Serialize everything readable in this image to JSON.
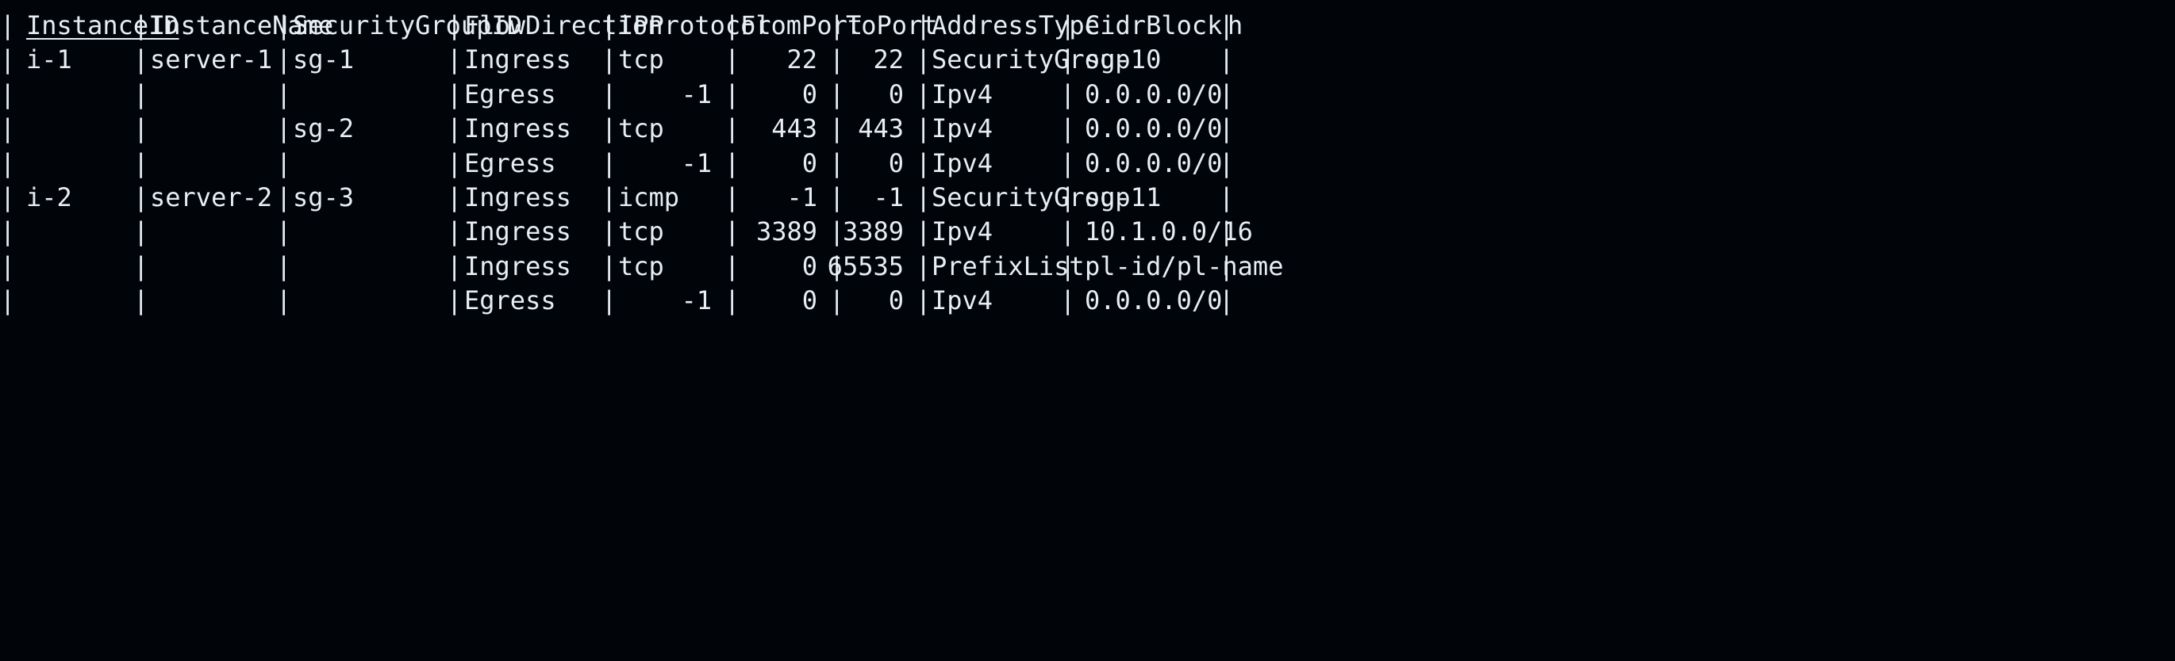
{
  "table": {
    "header": {
      "instance_id": "InstanceID",
      "instance_name": "InstanceName",
      "security_group_id": "SecurityGroupID",
      "flow_direction": "FlowDirection",
      "ip_protocol": "IPProtocol",
      "from_port": "FromPort",
      "to_port": "ToPort",
      "address_type": "AddressType",
      "cidr_block": "CidrBlock",
      "truncated": "h"
    },
    "rows": [
      {
        "instance_id": "i-1",
        "instance_name": "server-1",
        "security_group_id": "sg-1",
        "flow_direction": "Ingress",
        "ip_protocol": "tcp",
        "ip_protocol_num": "",
        "from_port": "22",
        "to_port": "22",
        "address_type": "SecurityGroup",
        "cidr_block": "sg-10"
      },
      {
        "instance_id": "",
        "instance_name": "",
        "security_group_id": "",
        "flow_direction": "Egress",
        "ip_protocol": "",
        "ip_protocol_num": "-1",
        "from_port": "0",
        "to_port": "0",
        "address_type": "Ipv4",
        "cidr_block": "0.0.0.0/0"
      },
      {
        "instance_id": "",
        "instance_name": "",
        "security_group_id": "sg-2",
        "flow_direction": "Ingress",
        "ip_protocol": "tcp",
        "ip_protocol_num": "",
        "from_port": "443",
        "to_port": "443",
        "address_type": "Ipv4",
        "cidr_block": "0.0.0.0/0"
      },
      {
        "instance_id": "",
        "instance_name": "",
        "security_group_id": "",
        "flow_direction": "Egress",
        "ip_protocol": "",
        "ip_protocol_num": "-1",
        "from_port": "0",
        "to_port": "0",
        "address_type": "Ipv4",
        "cidr_block": "0.0.0.0/0"
      },
      {
        "instance_id": "i-2",
        "instance_name": "server-2",
        "security_group_id": "sg-3",
        "flow_direction": "Ingress",
        "ip_protocol": "icmp",
        "ip_protocol_num": "",
        "from_port": "-1",
        "to_port": "-1",
        "address_type": "SecurityGroup",
        "cidr_block": "sg-11"
      },
      {
        "instance_id": "",
        "instance_name": "",
        "security_group_id": "",
        "flow_direction": "Ingress",
        "ip_protocol": "tcp",
        "ip_protocol_num": "",
        "from_port": "3389",
        "to_port": "3389",
        "address_type": "Ipv4",
        "cidr_block": "10.1.0.0/16"
      },
      {
        "instance_id": "",
        "instance_name": "",
        "security_group_id": "",
        "flow_direction": "Ingress",
        "ip_protocol": "tcp",
        "ip_protocol_num": "",
        "from_port": "0",
        "to_port": "65535",
        "address_type": "PrefixList",
        "cidr_block": "pl-id/pl-name"
      },
      {
        "instance_id": "",
        "instance_name": "",
        "security_group_id": "",
        "flow_direction": "Egress",
        "ip_protocol": "",
        "ip_protocol_num": "-1",
        "from_port": "0",
        "to_port": "0",
        "address_type": "Ipv4",
        "cidr_block": "0.0.0.0/0"
      }
    ]
  },
  "colors": {
    "background": "#010409",
    "foreground": "#e6edf3"
  }
}
